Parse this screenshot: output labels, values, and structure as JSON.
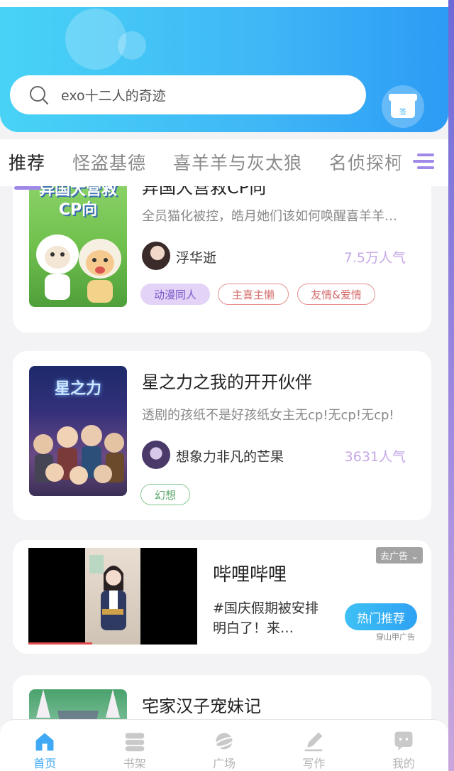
{
  "search": {
    "placeholder": "exo十二人的奇迹",
    "icon": "search-icon"
  },
  "sign": {
    "label": "签"
  },
  "tabs": [
    {
      "label": "推荐",
      "active": true
    },
    {
      "label": "怪盗基德"
    },
    {
      "label": "喜羊羊与灰太狼"
    },
    {
      "label": "名侦探柯"
    }
  ],
  "books": [
    {
      "cover_text": "异国大营救CP向",
      "title": "异国大营救CP向",
      "description": "全员猫化被控，皓月她们该如何唤醒喜羊羊…",
      "author": "浮华逝",
      "popularity": "7.5万人气",
      "tags": [
        "动漫同人",
        "主喜主懒",
        "友情&爱情"
      ]
    },
    {
      "cover_text": "星之力",
      "title": "星之力之我的开开伙伴",
      "description": "透剧的孩纸不是好孩纸女主无cp!无cp!无cp!",
      "author": "想象力非凡的芒果",
      "popularity": "3631人气",
      "tags": [
        "幻想"
      ]
    },
    {
      "title": "宅家汉子宠妹记"
    }
  ],
  "ad": {
    "title": "哔哩哔哩",
    "description": "#国庆假期被安排明白了！来…",
    "remove_label": "去广告",
    "button_label": "热门推荐",
    "source": "穿山甲广告"
  },
  "nav": [
    {
      "label": "首页",
      "icon": "home-icon",
      "active": true
    },
    {
      "label": "书架",
      "icon": "bookshelf-icon"
    },
    {
      "label": "广场",
      "icon": "planet-icon"
    },
    {
      "label": "写作",
      "icon": "pen-icon"
    },
    {
      "label": "我的",
      "icon": "chat-face-icon"
    }
  ],
  "colors": {
    "accent": "#3fa9f5",
    "tab_indicator": "#9f88e8",
    "popularity": "#c5a8e6"
  }
}
